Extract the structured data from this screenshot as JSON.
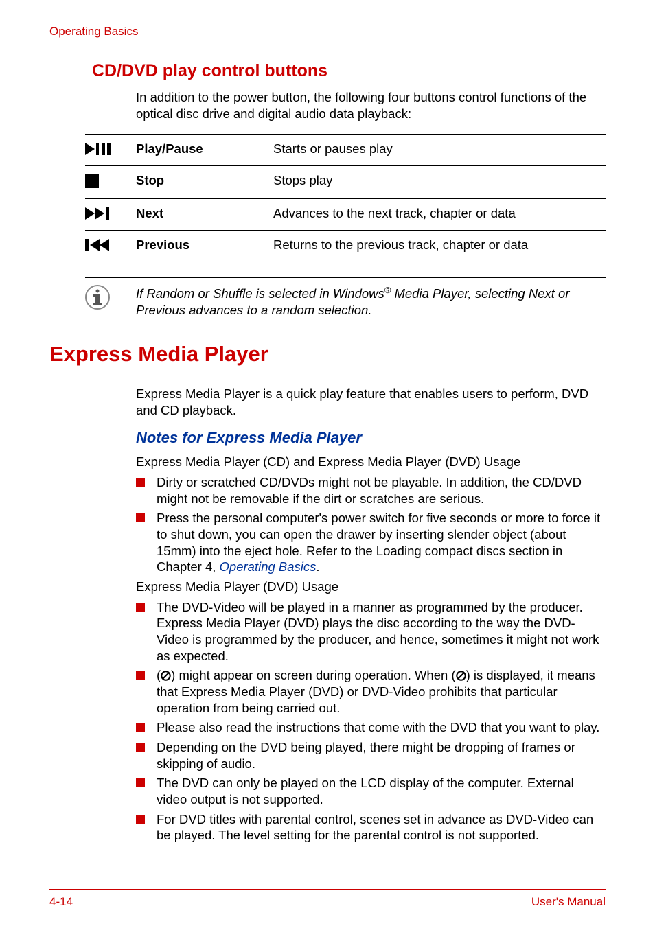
{
  "header": {
    "breadcrumb": "Operating Basics"
  },
  "section1": {
    "title": "CD/DVD play control buttons",
    "intro": "In addition to the power button, the following four buttons control functions of the optical disc drive and digital audio data playback:"
  },
  "buttons_table": [
    {
      "icon": "play-pause-icon",
      "label": "Play/Pause",
      "desc": "Starts or pauses play"
    },
    {
      "icon": "stop-icon",
      "label": "Stop",
      "desc": "Stops play"
    },
    {
      "icon": "next-icon",
      "label": "Next",
      "desc": "Advances to the next track, chapter or data"
    },
    {
      "icon": "previous-icon",
      "label": "Previous",
      "desc": "Returns to the previous track, chapter or data"
    }
  ],
  "note": {
    "text_pre": "If Random or Shuffle is selected in Windows",
    "reg": "®",
    "text_post": " Media Player, selecting Next or Previous advances to a random selection."
  },
  "section2": {
    "title": "Express Media Player",
    "intro": "Express Media Player is a quick play feature that enables users to perform, DVD and CD playback.",
    "subhead": "Notes for Express Media Player",
    "usage_cd_dvd": "Express Media Player (CD) and Express Media Player (DVD) Usage",
    "list1": [
      {
        "text": "Dirty or scratched CD/DVDs might not be playable. In addition, the CD/DVD might not be removable if the dirt or scratches are serious."
      },
      {
        "text_pre": "Press the personal computer's power switch for five seconds or more to force it to shut down, you can open the drawer by inserting slender object (about 15mm) into the eject hole. Refer to the Loading compact discs section in Chapter 4, ",
        "link": "Operating Basics",
        "text_post": "."
      }
    ],
    "usage_dvd": "Express Media Player (DVD) Usage",
    "list2": [
      {
        "text": "The DVD-Video will be played in a manner as programmed by the producer. Express Media Player (DVD) plays the disc according to the way the DVD-Video is programmed by the producer, and hence, sometimes it might not work as expected."
      },
      {
        "prohibit": true,
        "text_pre": "(",
        "text_mid": ") might appear on screen during operation. When (",
        "text_post": ") is displayed, it means that Express Media Player (DVD) or DVD-Video prohibits that particular operation from being carried out."
      },
      {
        "text": "Please also read the instructions that come with the DVD that you want to play."
      },
      {
        "text": "Depending on the DVD being played, there might be dropping of frames or skipping of audio."
      },
      {
        "text": "The DVD can only be played on the LCD display of the computer. External video output is not supported."
      },
      {
        "text": "For DVD titles with parental control, scenes set in advance as DVD-Video can be played. The level setting for the parental control is not supported."
      }
    ]
  },
  "footer": {
    "left": "4-14",
    "right": "User's Manual"
  }
}
